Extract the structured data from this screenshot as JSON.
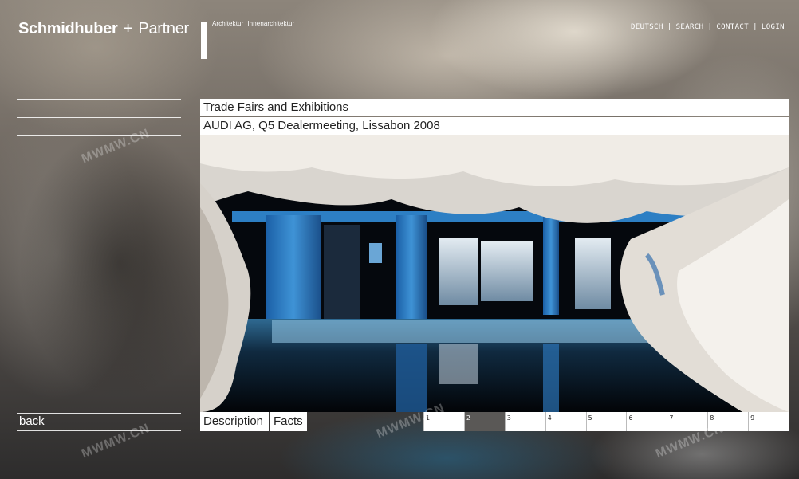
{
  "brand": {
    "name": "Schmidhuber",
    "plus": "+",
    "partner": "Partner"
  },
  "tagline": [
    "Architektur",
    "Innenarchitektur"
  ],
  "topnav": [
    {
      "label": "DEUTSCH"
    },
    {
      "label": "SEARCH"
    },
    {
      "label": "CONTACT"
    },
    {
      "label": "LOGIN"
    }
  ],
  "topnav_separator": "|",
  "category": "Trade Fairs and Exhibitions",
  "project": "AUDI AG,  Q5 Dealermeeting, Lissabon 2008",
  "tabs": {
    "description": "Description",
    "facts": "Facts"
  },
  "back_label": "back",
  "pages": [
    "1",
    "2",
    "3",
    "4",
    "5",
    "6",
    "7",
    "8",
    "9"
  ],
  "active_page": "2",
  "watermark": "MWMW.CN",
  "colors": {
    "active_page_bg": "#5a5856",
    "bar_bg": "#ffffff"
  }
}
